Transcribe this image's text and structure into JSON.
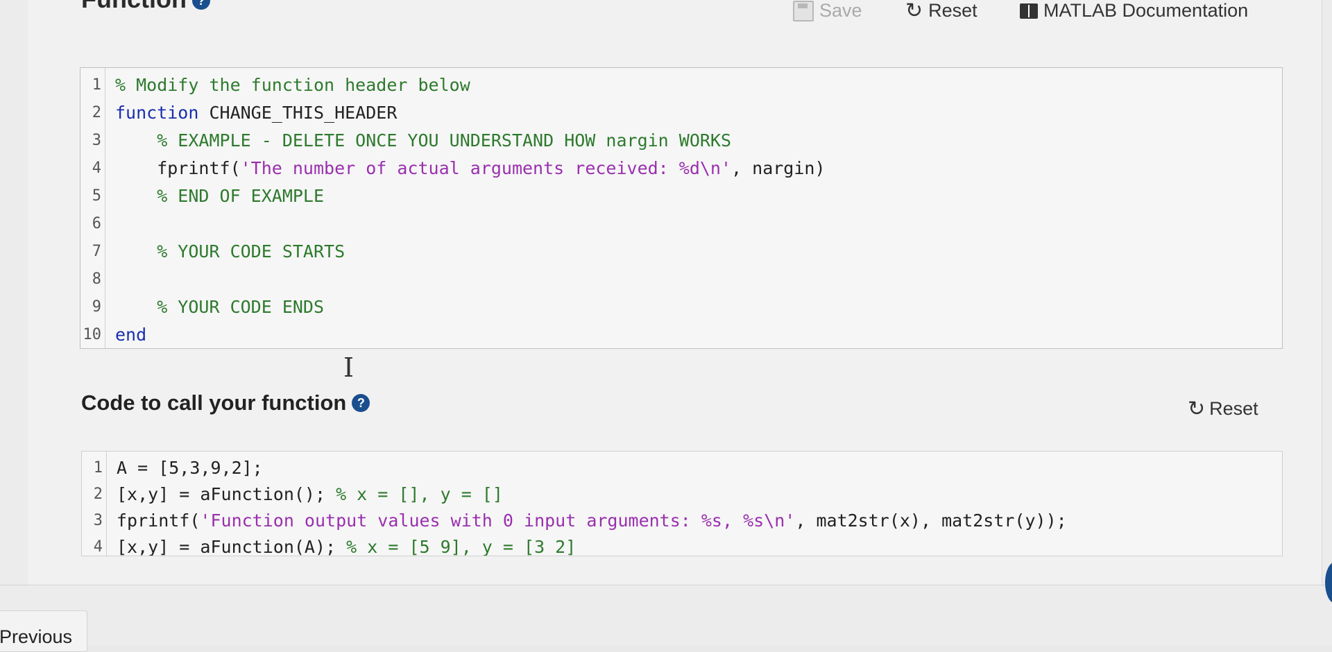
{
  "header": {
    "title": "Function",
    "help_icon": "?"
  },
  "toolbar": {
    "save_label": "Save",
    "reset_label": "Reset",
    "doc_label": "MATLAB Documentation",
    "icons": [
      "save-icon",
      "reset-icon",
      "book-icon"
    ]
  },
  "editor": {
    "lines": [
      {
        "num": "1",
        "parts": [
          {
            "t": "% Modify the function header below",
            "c": "cmt"
          }
        ]
      },
      {
        "num": "2",
        "parts": [
          {
            "t": "function",
            "c": "kw"
          },
          {
            "t": " CHANGE_THIS_HEADER",
            "c": ""
          }
        ]
      },
      {
        "num": "3",
        "parts": [
          {
            "t": "    % EXAMPLE - DELETE ONCE YOU UNDERSTAND HOW nargin WORKS",
            "c": "cmt"
          }
        ]
      },
      {
        "num": "4",
        "parts": [
          {
            "t": "    fprintf(",
            "c": ""
          },
          {
            "t": "'The number of actual arguments received: %d\\n'",
            "c": "str"
          },
          {
            "t": ", nargin)",
            "c": ""
          }
        ]
      },
      {
        "num": "5",
        "parts": [
          {
            "t": "    % END OF EXAMPLE",
            "c": "cmt"
          }
        ]
      },
      {
        "num": "6",
        "parts": [
          {
            "t": "",
            "c": ""
          }
        ]
      },
      {
        "num": "7",
        "parts": [
          {
            "t": "    % YOUR CODE STARTS",
            "c": "cmt"
          }
        ]
      },
      {
        "num": "8",
        "parts": [
          {
            "t": "",
            "c": ""
          }
        ]
      },
      {
        "num": "9",
        "parts": [
          {
            "t": "    % YOUR CODE ENDS",
            "c": "cmt"
          }
        ]
      },
      {
        "num": "10",
        "parts": [
          {
            "t": "end",
            "c": "kw"
          }
        ]
      }
    ]
  },
  "call_section": {
    "title": "Code to call your function",
    "help_icon": "?",
    "reset_label": "Reset",
    "lines": [
      {
        "num": "1",
        "parts": [
          {
            "t": "A = [5,3,9,2];",
            "c": ""
          }
        ]
      },
      {
        "num": "2",
        "parts": [
          {
            "t": "[x,y] = aFunction(); ",
            "c": ""
          },
          {
            "t": "% x = [], y = []",
            "c": "cmt"
          }
        ]
      },
      {
        "num": "3",
        "parts": [
          {
            "t": "fprintf(",
            "c": ""
          },
          {
            "t": "'Function output values with 0 input arguments: %s, %s\\n'",
            "c": "str"
          },
          {
            "t": ", mat2str(x), mat2str(y));",
            "c": ""
          }
        ]
      },
      {
        "num": "4",
        "parts": [
          {
            "t": "[x,y] = aFunction(A); ",
            "c": ""
          },
          {
            "t": "% x = [5 9], y = [3 2]",
            "c": "cmt"
          }
        ]
      }
    ]
  },
  "footer": {
    "previous_label": "Previous"
  }
}
